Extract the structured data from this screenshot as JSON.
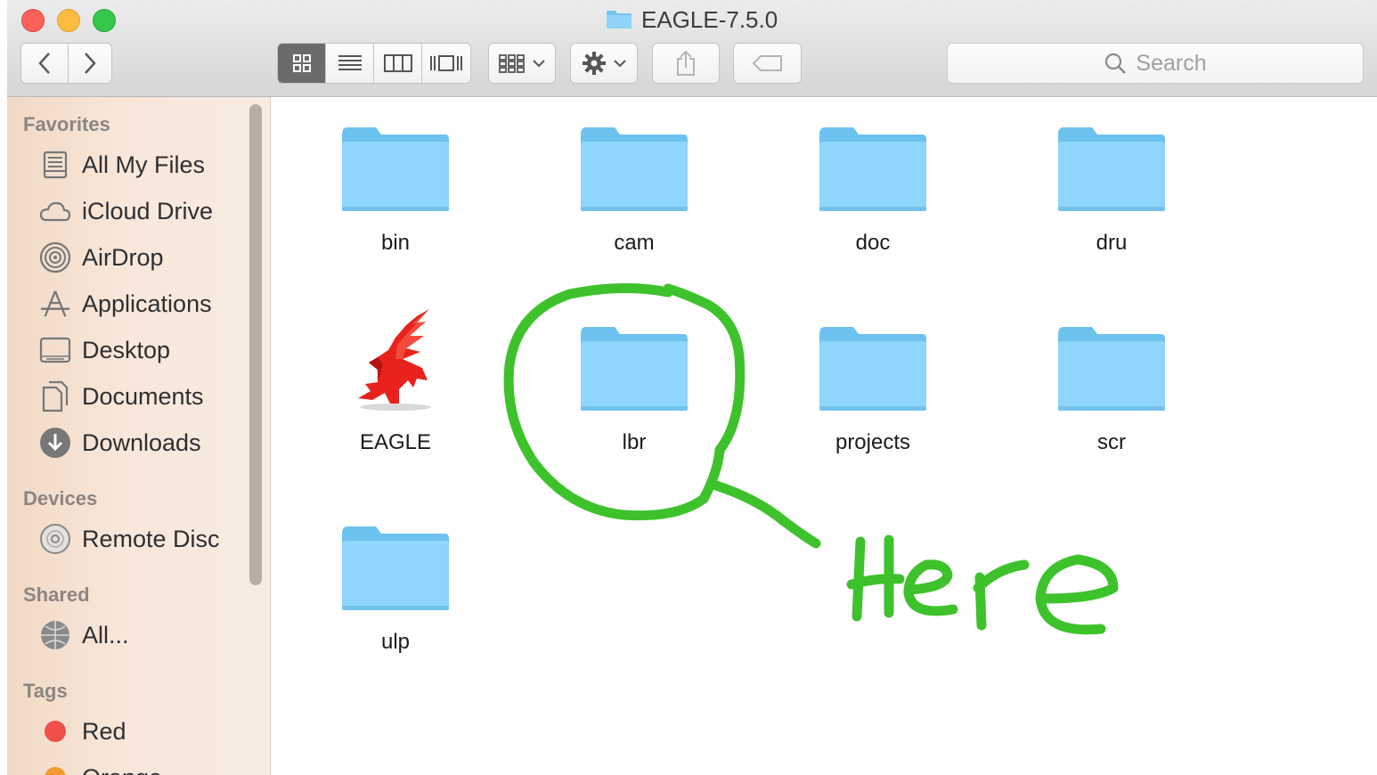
{
  "window": {
    "title": "EAGLE-7.5.0"
  },
  "toolbar": {
    "back_icon": "chevron-left-icon",
    "forward_icon": "chevron-right-icon",
    "view_modes": [
      "icon-view",
      "list-view",
      "column-view",
      "cover-flow-view"
    ],
    "arrange_icon": "grid-arrange-icon",
    "action_icon": "gear-icon",
    "share_icon": "share-icon",
    "tag_icon": "tag-icon"
  },
  "search": {
    "placeholder": "Search"
  },
  "sidebar": {
    "favorites_label": "Favorites",
    "favorites": [
      {
        "label": "All My Files",
        "icon": "all-files-icon"
      },
      {
        "label": "iCloud Drive",
        "icon": "cloud-icon"
      },
      {
        "label": "AirDrop",
        "icon": "airdrop-icon"
      },
      {
        "label": "Applications",
        "icon": "applications-icon"
      },
      {
        "label": "Desktop",
        "icon": "desktop-icon"
      },
      {
        "label": "Documents",
        "icon": "documents-icon"
      },
      {
        "label": "Downloads",
        "icon": "downloads-icon"
      }
    ],
    "devices_label": "Devices",
    "devices": [
      {
        "label": "Remote Disc",
        "icon": "disc-icon"
      }
    ],
    "shared_label": "Shared",
    "shared": [
      {
        "label": "All...",
        "icon": "network-icon"
      }
    ],
    "tags_label": "Tags",
    "tags": [
      {
        "label": "Red",
        "color": "#f0504a"
      },
      {
        "label": "Orange",
        "color": "#f59a31"
      }
    ]
  },
  "files": [
    {
      "name": "bin",
      "type": "folder"
    },
    {
      "name": "cam",
      "type": "folder"
    },
    {
      "name": "doc",
      "type": "folder"
    },
    {
      "name": "dru",
      "type": "folder"
    },
    {
      "name": "EAGLE",
      "type": "application"
    },
    {
      "name": "lbr",
      "type": "folder"
    },
    {
      "name": "projects",
      "type": "folder"
    },
    {
      "name": "scr",
      "type": "folder"
    },
    {
      "name": "ulp",
      "type": "folder"
    }
  ],
  "annotation": {
    "text": "Here",
    "color": "#3ec22c"
  }
}
